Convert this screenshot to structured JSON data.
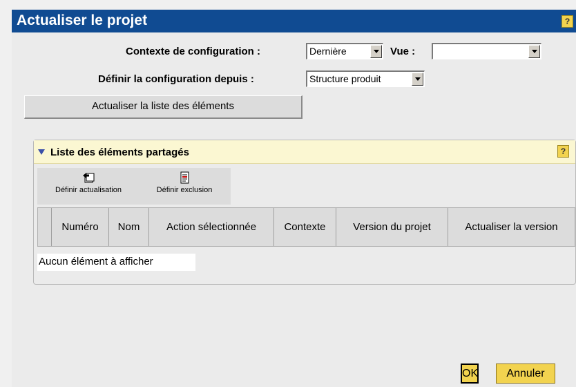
{
  "dialog": {
    "title": "Actualiser le projet",
    "help_label": "?"
  },
  "form": {
    "context_label": "Contexte de configuration :",
    "context_value": "Dernière",
    "view_label": "Vue :",
    "view_value": "",
    "source_label": "Définir la configuration depuis :",
    "source_value": "Structure produit"
  },
  "refresh_button": "Actualiser la liste des éléments",
  "panel": {
    "title": "Liste des éléments partagés",
    "help_label": "?",
    "toolbar": [
      {
        "label": "Définir actualisation",
        "icon": "define-update-icon"
      },
      {
        "label": "Définir exclusion",
        "icon": "define-exclusion-icon"
      }
    ],
    "columns": [
      "",
      "Numéro",
      "Nom",
      "Action sélectionnée",
      "Contexte",
      "Version du projet",
      "Actualiser la version"
    ],
    "empty_message": "Aucun élément à afficher"
  },
  "footer": {
    "ok": "OK",
    "cancel": "Annuler"
  },
  "colors": {
    "title_bar": "#104b92",
    "panel_header": "#fbf7d2",
    "button_yellow": "#f2d34f"
  }
}
